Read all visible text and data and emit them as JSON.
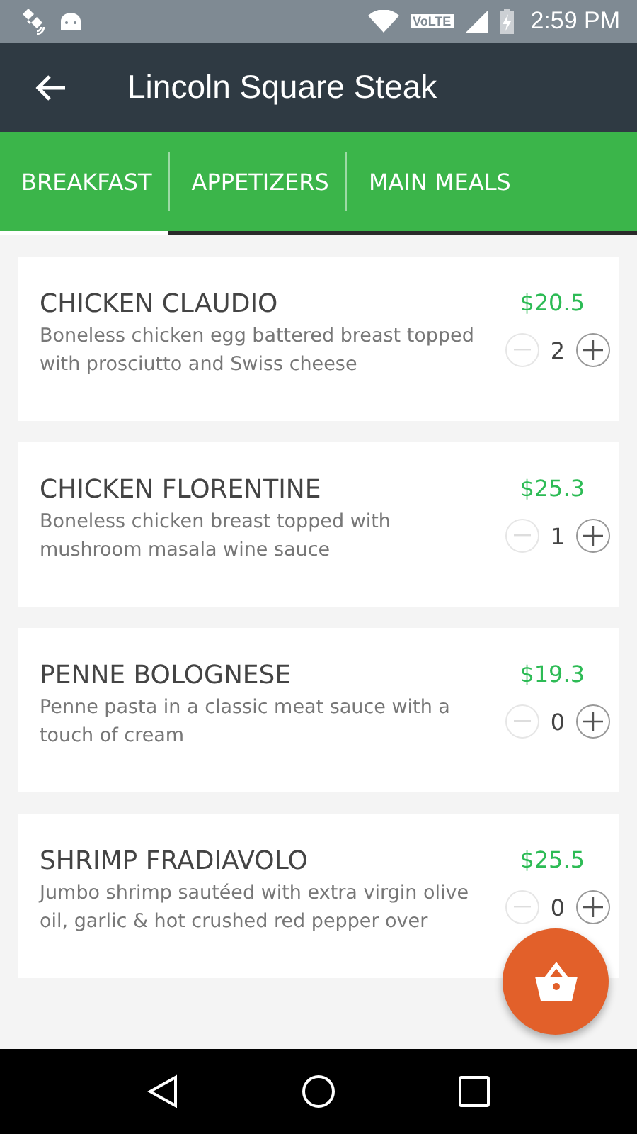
{
  "status_bar": {
    "network_label": "VoLTE",
    "time": "2:59 PM"
  },
  "app_bar": {
    "title": "Lincoln Square Steak"
  },
  "tabs": [
    {
      "label": "BREAKFAST",
      "selected": true
    },
    {
      "label": "APPETIZERS",
      "selected": false
    },
    {
      "label": "MAIN MEALS",
      "selected": false
    }
  ],
  "items": [
    {
      "name": "CHICKEN CLAUDIO",
      "description": "Boneless chicken egg battered breast topped with prosciutto and Swiss cheese",
      "price": "$20.5",
      "quantity": "2"
    },
    {
      "name": "CHICKEN FLORENTINE",
      "description": "Boneless chicken breast topped with mushroom masala wine sauce",
      "price": "$25.3",
      "quantity": "1"
    },
    {
      "name": "PENNE BOLOGNESE",
      "description": "Penne pasta in a classic meat sauce with a touch of cream",
      "price": "$19.3",
      "quantity": "0"
    },
    {
      "name": "SHRIMP FRADIAVOLO",
      "description": "Jumbo shrimp sautéed with extra virgin olive oil, garlic & hot crushed red pepper over",
      "price": "$25.5",
      "quantity": "0"
    }
  ]
}
